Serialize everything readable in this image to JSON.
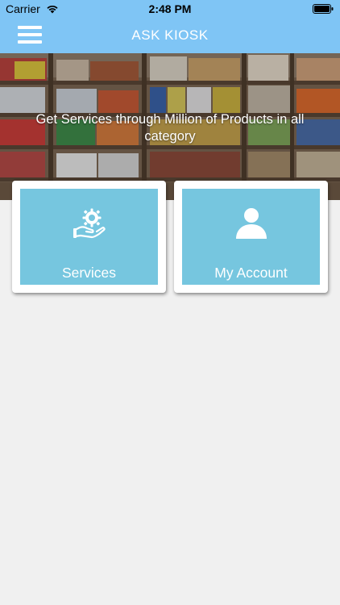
{
  "status_bar": {
    "carrier": "Carrier",
    "time": "2:48 PM"
  },
  "nav": {
    "title": "ASK KIOSK"
  },
  "banner": {
    "caption": "Get Services through Million of Products in all category"
  },
  "tiles": [
    {
      "label": "Services",
      "icon": "hand-gear-icon"
    },
    {
      "label": "My Account",
      "icon": "user-icon"
    }
  ],
  "colors": {
    "header": "#7fc5f5",
    "tile": "#76c6df",
    "page_background": "#f0f0f0"
  }
}
